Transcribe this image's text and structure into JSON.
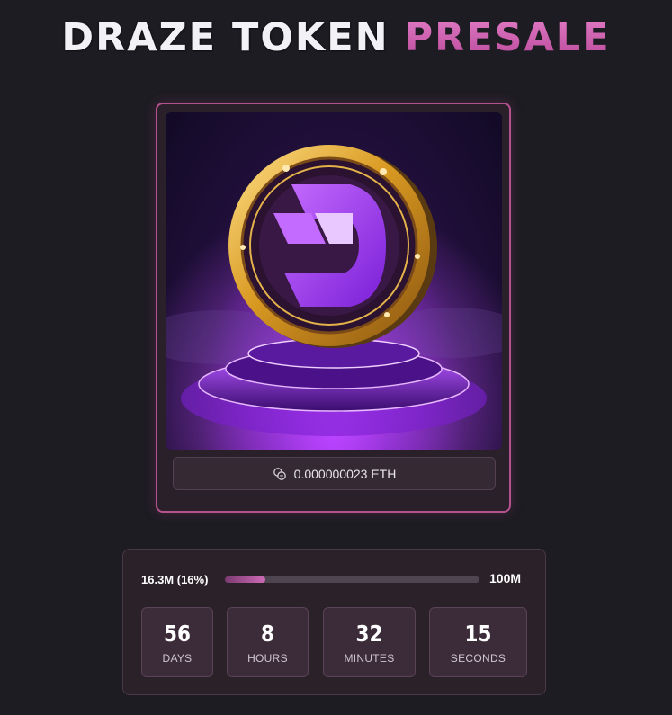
{
  "header": {
    "title_part1": "DRAZE TOKEN",
    "title_part2": "PRESALE"
  },
  "token_card": {
    "image_icon": "draze-coin-on-podium",
    "price_label": "0.000000023 ETH",
    "price_icon": "coins-icon"
  },
  "presale": {
    "raised_label": "16.3M (16%)",
    "progress_percent": 16,
    "goal_label": "100M",
    "countdown": [
      {
        "value": "56",
        "unit": "DAYS"
      },
      {
        "value": "8",
        "unit": "HOURS"
      },
      {
        "value": "32",
        "unit": "MINUTES"
      },
      {
        "value": "15",
        "unit": "SECONDS"
      }
    ]
  },
  "colors": {
    "background": "#1d1c22",
    "accent_pink": "#c55aa9",
    "card_border": "#b4528f"
  }
}
